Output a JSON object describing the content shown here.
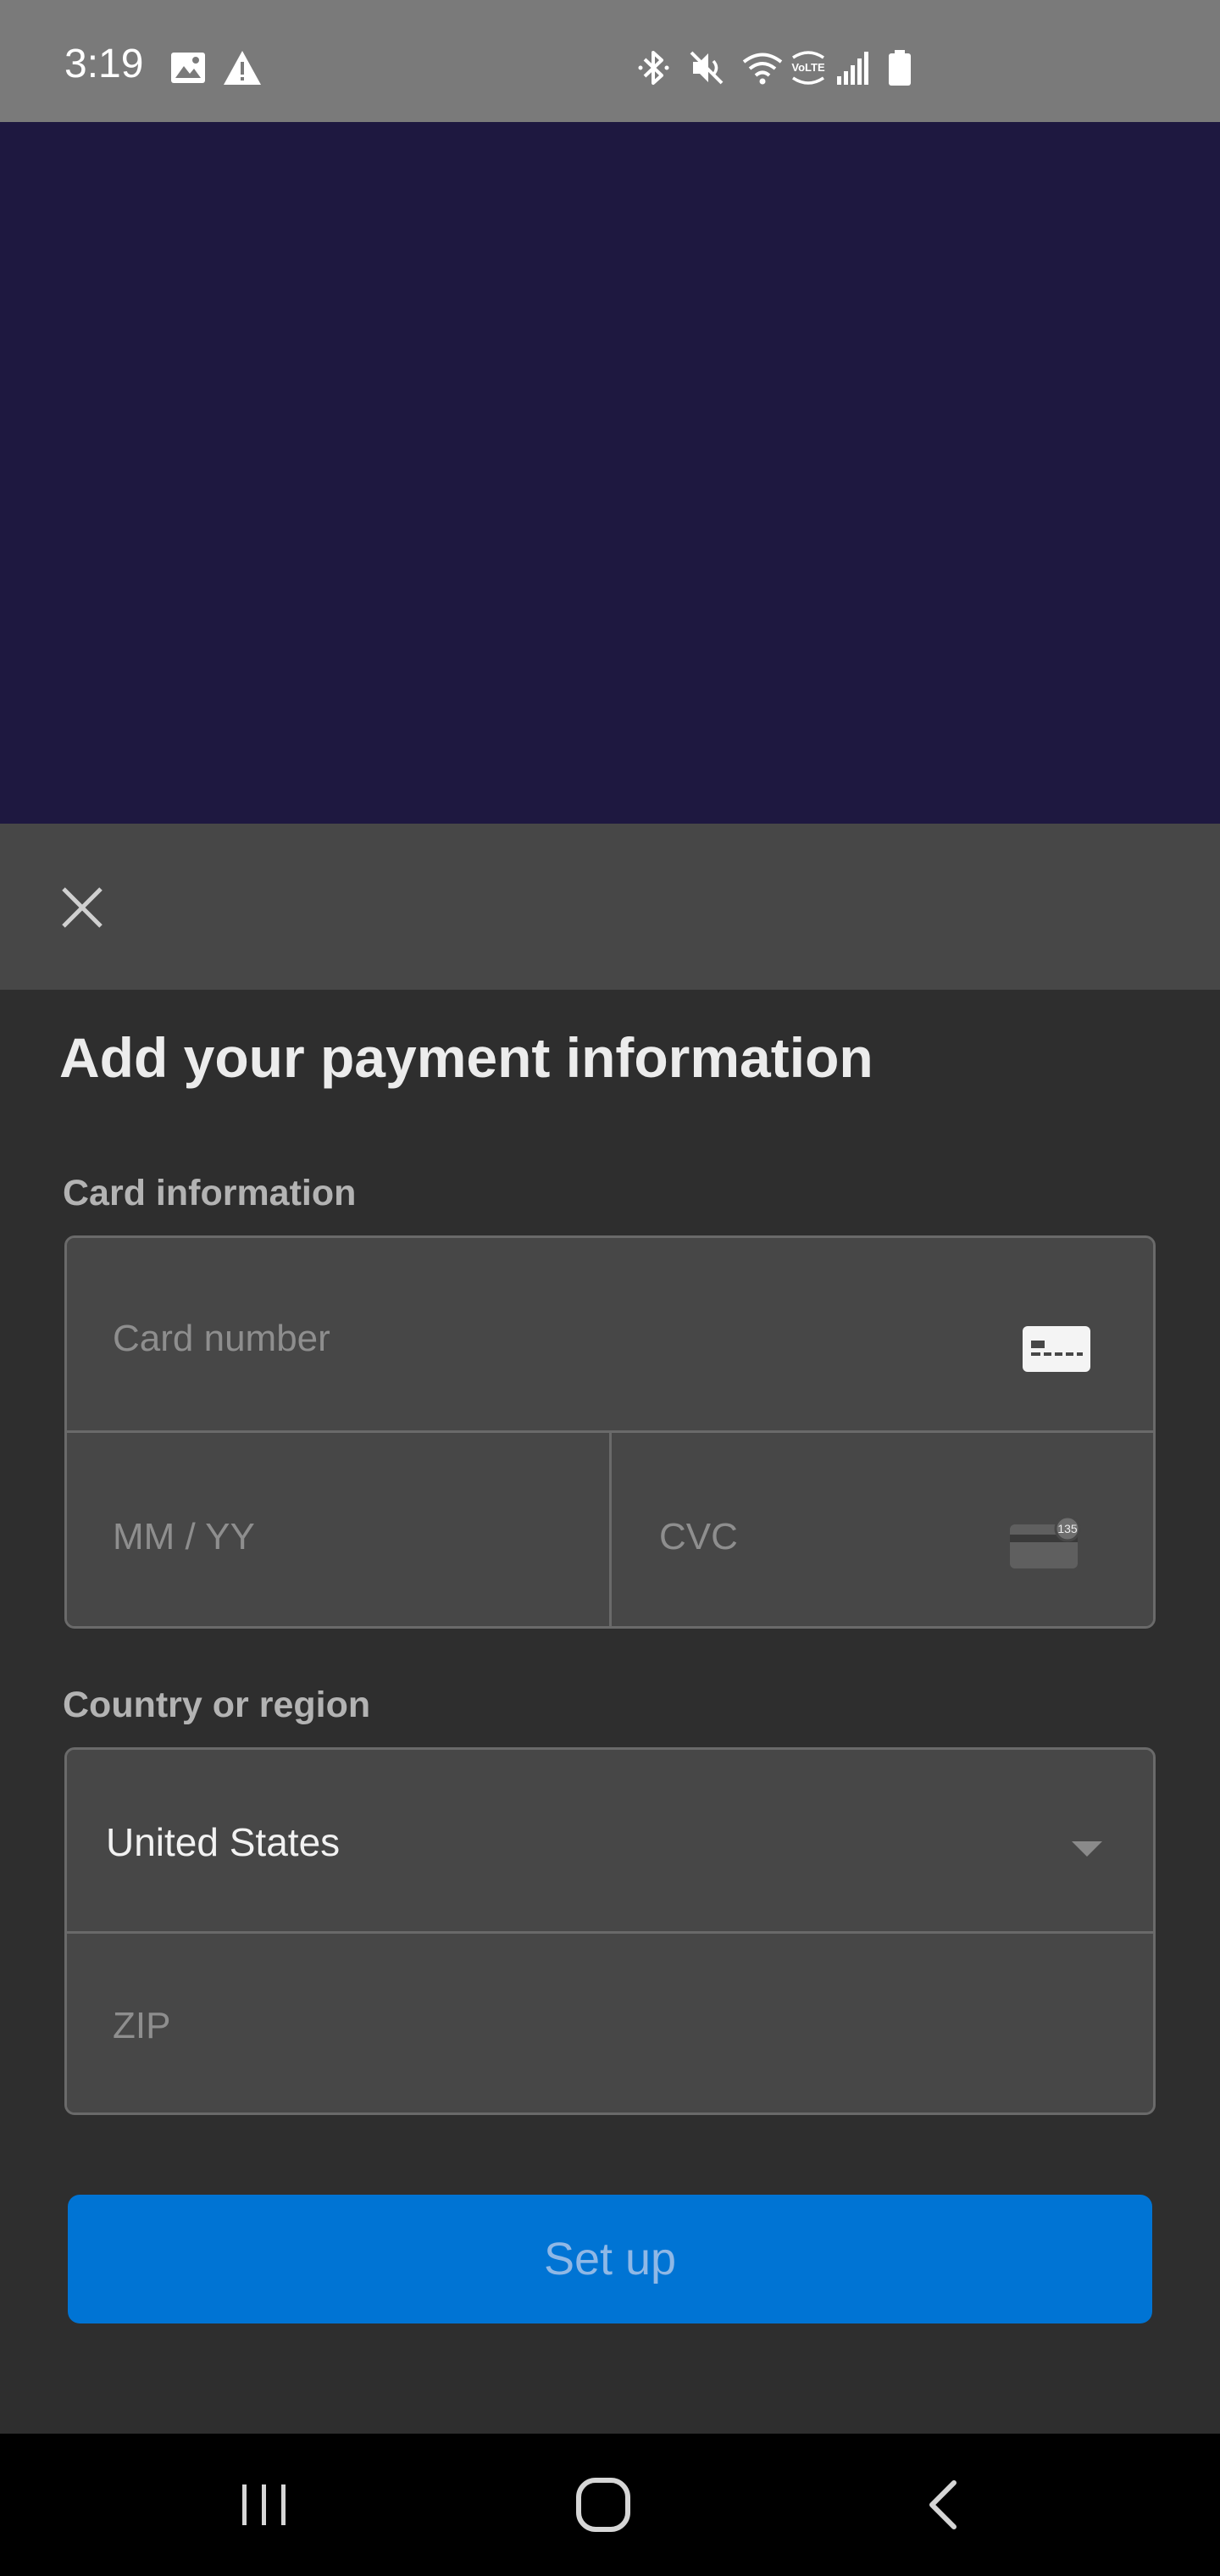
{
  "status_bar": {
    "time": "3:19",
    "left_icons": [
      "image-icon",
      "warning-icon"
    ],
    "right_icons": [
      "bluetooth-icon",
      "mute-icon",
      "wifi-icon",
      "volte-icon",
      "signal-icon",
      "battery-icon"
    ],
    "volte_label": "VoLTE"
  },
  "sheet": {
    "title": "Add your payment information",
    "card_section_label": "Card information",
    "card_number_placeholder": "Card number",
    "expiry_placeholder": "MM / YY",
    "cvc_placeholder": "CVC",
    "cvc_icon_text": "135",
    "country_section_label": "Country or region",
    "country_value": "United States",
    "zip_placeholder": "ZIP",
    "setup_button_label": "Set up"
  },
  "colors": {
    "status_bar": "#7a7a7a",
    "backdrop": "#1e1840",
    "sheet_header": "#474747",
    "sheet_body": "#2e2e2e",
    "field_bg": "#474747",
    "button_bg": "#0074d4",
    "button_text": "#8fb8e6"
  },
  "nav_bar": {
    "icons": [
      "recent-apps-icon",
      "home-icon",
      "back-icon"
    ]
  }
}
